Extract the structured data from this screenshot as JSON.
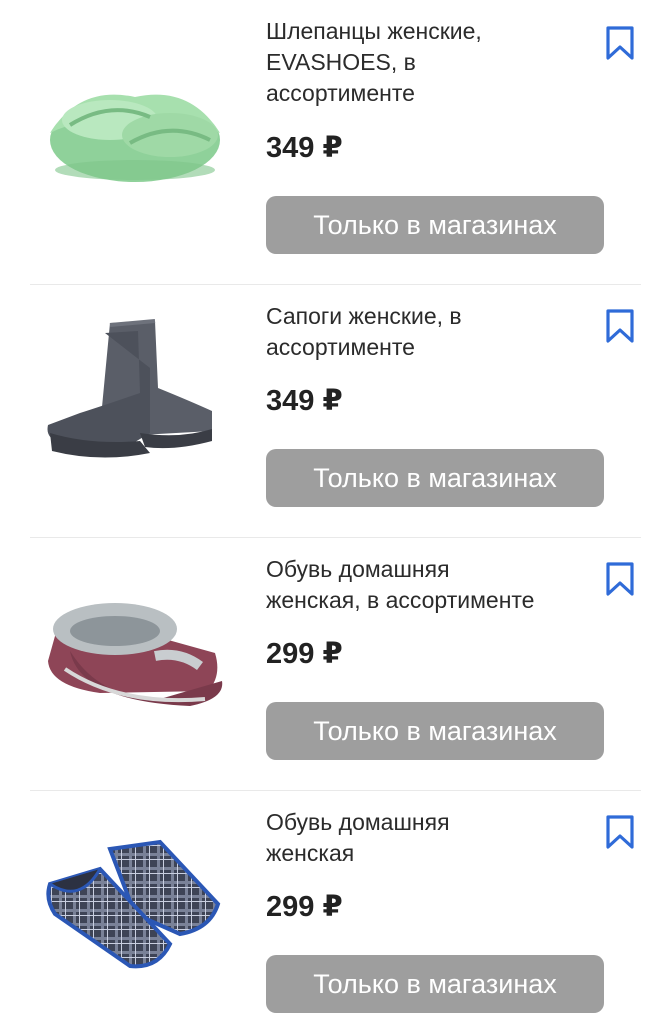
{
  "products": [
    {
      "title": "Шлепанцы женские,\nEVASHOES, в\nассортименте",
      "price": "349 ₽",
      "button_label": "Только в магазинах",
      "image": "green-slide-sandals"
    },
    {
      "title": "Сапоги женские, в\nассортименте",
      "price": "349 ₽",
      "button_label": "Только в магазинах",
      "image": "grey-rubber-boots"
    },
    {
      "title": "Обувь домашняя\nженская, в ассортименте",
      "price": "299 ₽",
      "button_label": "Только в магазинах",
      "image": "burgundy-fur-slippers"
    },
    {
      "title": "Обувь домашняя\nженская",
      "price": "299 ₽",
      "button_label": "Только в магазинах",
      "image": "plaid-house-slippers"
    }
  ],
  "colors": {
    "accent": "#2f6bd8",
    "button_bg": "#9e9e9e",
    "text": "#262626"
  },
  "icons": {
    "bookmark": "bookmark-icon"
  }
}
